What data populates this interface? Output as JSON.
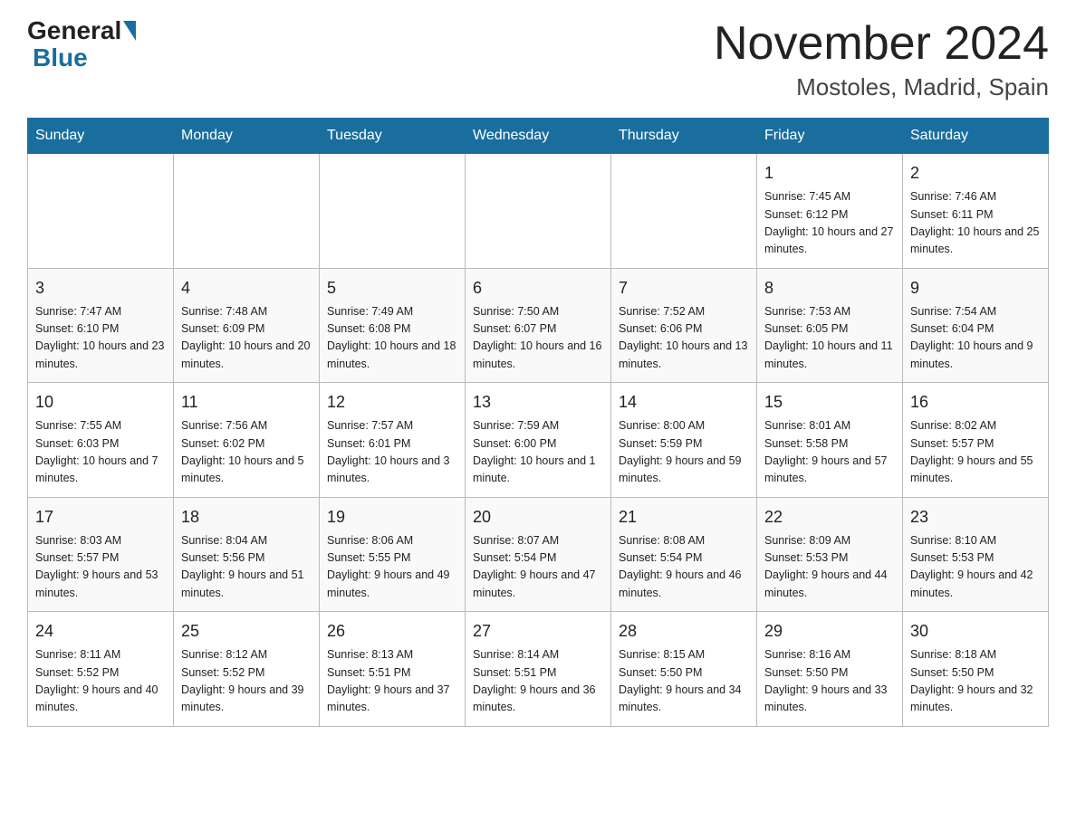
{
  "logo": {
    "general": "General",
    "blue": "Blue"
  },
  "title": {
    "month_year": "November 2024",
    "location": "Mostoles, Madrid, Spain"
  },
  "days_of_week": [
    "Sunday",
    "Monday",
    "Tuesday",
    "Wednesday",
    "Thursday",
    "Friday",
    "Saturday"
  ],
  "weeks": [
    [
      {
        "day": "",
        "info": ""
      },
      {
        "day": "",
        "info": ""
      },
      {
        "day": "",
        "info": ""
      },
      {
        "day": "",
        "info": ""
      },
      {
        "day": "",
        "info": ""
      },
      {
        "day": "1",
        "info": "Sunrise: 7:45 AM\nSunset: 6:12 PM\nDaylight: 10 hours and 27 minutes."
      },
      {
        "day": "2",
        "info": "Sunrise: 7:46 AM\nSunset: 6:11 PM\nDaylight: 10 hours and 25 minutes."
      }
    ],
    [
      {
        "day": "3",
        "info": "Sunrise: 7:47 AM\nSunset: 6:10 PM\nDaylight: 10 hours and 23 minutes."
      },
      {
        "day": "4",
        "info": "Sunrise: 7:48 AM\nSunset: 6:09 PM\nDaylight: 10 hours and 20 minutes."
      },
      {
        "day": "5",
        "info": "Sunrise: 7:49 AM\nSunset: 6:08 PM\nDaylight: 10 hours and 18 minutes."
      },
      {
        "day": "6",
        "info": "Sunrise: 7:50 AM\nSunset: 6:07 PM\nDaylight: 10 hours and 16 minutes."
      },
      {
        "day": "7",
        "info": "Sunrise: 7:52 AM\nSunset: 6:06 PM\nDaylight: 10 hours and 13 minutes."
      },
      {
        "day": "8",
        "info": "Sunrise: 7:53 AM\nSunset: 6:05 PM\nDaylight: 10 hours and 11 minutes."
      },
      {
        "day": "9",
        "info": "Sunrise: 7:54 AM\nSunset: 6:04 PM\nDaylight: 10 hours and 9 minutes."
      }
    ],
    [
      {
        "day": "10",
        "info": "Sunrise: 7:55 AM\nSunset: 6:03 PM\nDaylight: 10 hours and 7 minutes."
      },
      {
        "day": "11",
        "info": "Sunrise: 7:56 AM\nSunset: 6:02 PM\nDaylight: 10 hours and 5 minutes."
      },
      {
        "day": "12",
        "info": "Sunrise: 7:57 AM\nSunset: 6:01 PM\nDaylight: 10 hours and 3 minutes."
      },
      {
        "day": "13",
        "info": "Sunrise: 7:59 AM\nSunset: 6:00 PM\nDaylight: 10 hours and 1 minute."
      },
      {
        "day": "14",
        "info": "Sunrise: 8:00 AM\nSunset: 5:59 PM\nDaylight: 9 hours and 59 minutes."
      },
      {
        "day": "15",
        "info": "Sunrise: 8:01 AM\nSunset: 5:58 PM\nDaylight: 9 hours and 57 minutes."
      },
      {
        "day": "16",
        "info": "Sunrise: 8:02 AM\nSunset: 5:57 PM\nDaylight: 9 hours and 55 minutes."
      }
    ],
    [
      {
        "day": "17",
        "info": "Sunrise: 8:03 AM\nSunset: 5:57 PM\nDaylight: 9 hours and 53 minutes."
      },
      {
        "day": "18",
        "info": "Sunrise: 8:04 AM\nSunset: 5:56 PM\nDaylight: 9 hours and 51 minutes."
      },
      {
        "day": "19",
        "info": "Sunrise: 8:06 AM\nSunset: 5:55 PM\nDaylight: 9 hours and 49 minutes."
      },
      {
        "day": "20",
        "info": "Sunrise: 8:07 AM\nSunset: 5:54 PM\nDaylight: 9 hours and 47 minutes."
      },
      {
        "day": "21",
        "info": "Sunrise: 8:08 AM\nSunset: 5:54 PM\nDaylight: 9 hours and 46 minutes."
      },
      {
        "day": "22",
        "info": "Sunrise: 8:09 AM\nSunset: 5:53 PM\nDaylight: 9 hours and 44 minutes."
      },
      {
        "day": "23",
        "info": "Sunrise: 8:10 AM\nSunset: 5:53 PM\nDaylight: 9 hours and 42 minutes."
      }
    ],
    [
      {
        "day": "24",
        "info": "Sunrise: 8:11 AM\nSunset: 5:52 PM\nDaylight: 9 hours and 40 minutes."
      },
      {
        "day": "25",
        "info": "Sunrise: 8:12 AM\nSunset: 5:52 PM\nDaylight: 9 hours and 39 minutes."
      },
      {
        "day": "26",
        "info": "Sunrise: 8:13 AM\nSunset: 5:51 PM\nDaylight: 9 hours and 37 minutes."
      },
      {
        "day": "27",
        "info": "Sunrise: 8:14 AM\nSunset: 5:51 PM\nDaylight: 9 hours and 36 minutes."
      },
      {
        "day": "28",
        "info": "Sunrise: 8:15 AM\nSunset: 5:50 PM\nDaylight: 9 hours and 34 minutes."
      },
      {
        "day": "29",
        "info": "Sunrise: 8:16 AM\nSunset: 5:50 PM\nDaylight: 9 hours and 33 minutes."
      },
      {
        "day": "30",
        "info": "Sunrise: 8:18 AM\nSunset: 5:50 PM\nDaylight: 9 hours and 32 minutes."
      }
    ]
  ]
}
